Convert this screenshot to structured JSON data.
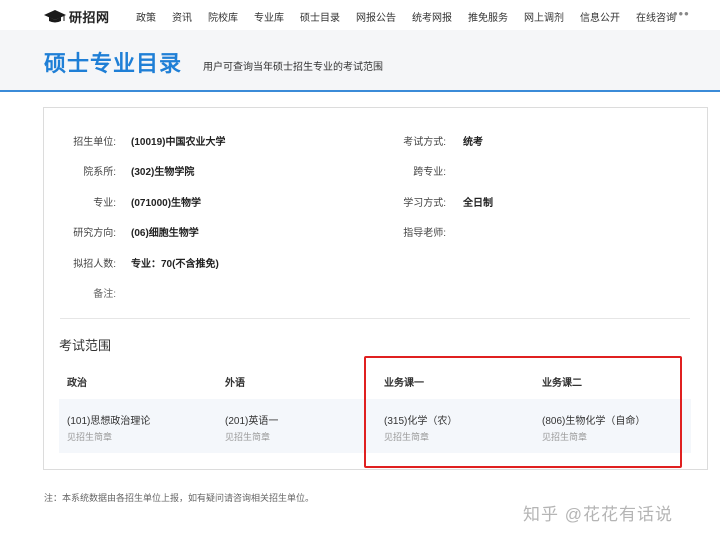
{
  "site": {
    "logo_text": "研招网"
  },
  "nav": {
    "items": [
      "政策",
      "资讯",
      "院校库",
      "专业库",
      "硕士目录",
      "网报公告",
      "统考网报",
      "推免服务",
      "网上调剂",
      "信息公开",
      "在线咨询"
    ],
    "more": "•••"
  },
  "header": {
    "title": "硕士专业目录",
    "subtitle": "用户可查询当年硕士招生专业的考试范围"
  },
  "info": {
    "unit_label": "招生单位:",
    "unit": "(10019)中国农业大学",
    "dept_label": "院系所:",
    "dept": "(302)生物学院",
    "major_label": "专业:",
    "major": "(071000)生物学",
    "direction_label": "研究方向:",
    "direction": "(06)细胞生物学",
    "quota_label": "拟招人数:",
    "quota": "专业：70(不含推免)",
    "remark_label": "备注:",
    "remark": "",
    "exam_label": "考试方式:",
    "exam": "统考",
    "cross_label": "跨专业:",
    "cross": "",
    "study_label": "学习方式:",
    "study": "全日制",
    "advisor_label": "指导老师:",
    "advisor": ""
  },
  "exam_scope": {
    "title": "考试范围",
    "headers": [
      "政治",
      "外语",
      "业务课一",
      "业务课二"
    ],
    "subjects": [
      "(101)思想政治理论",
      "(201)英语一",
      "(315)化学（农）",
      "(806)生物化学（自命）"
    ],
    "note": "见招生简章"
  },
  "footer": {
    "note": "注：本系统数据由各招生单位上报，如有疑问请咨询相关招生单位。",
    "watermark": "知乎 @花花有话说"
  },
  "colors": {
    "accent": "#1f7fd6",
    "highlight": "#e02020"
  }
}
